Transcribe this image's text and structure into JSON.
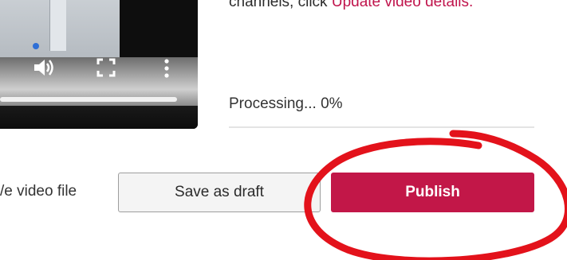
{
  "description": {
    "text_before": "channels, click ",
    "link_text": "Update video details."
  },
  "upload": {
    "status_text": "Processing... 0%"
  },
  "actions": {
    "file_label_text": "/e video file",
    "save_draft_label": "Save as draft",
    "publish_label": "Publish"
  },
  "player": {
    "icons": [
      "volume-icon",
      "fullscreen-icon",
      "more-options-icon"
    ]
  },
  "colors": {
    "accent": "#c21748",
    "link": "#c0144c",
    "annotation": "#e3121b"
  }
}
